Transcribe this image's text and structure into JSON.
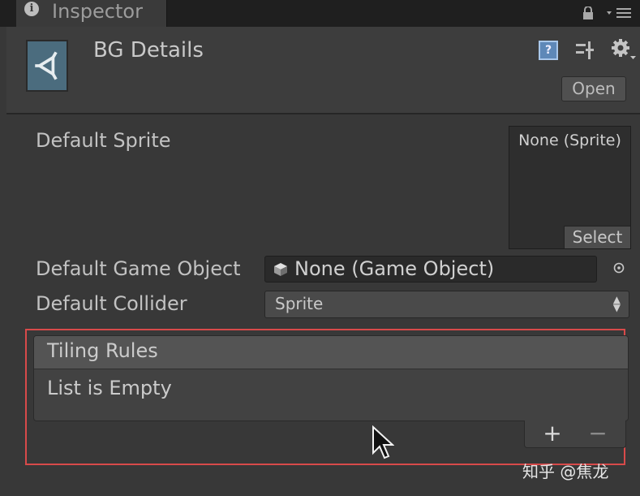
{
  "tab": {
    "title": "Inspector",
    "info_glyph": "i",
    "lock_icon": "lock-icon",
    "menu_icon": "menu-icon"
  },
  "header": {
    "asset_title": "BG Details",
    "help_glyph": "?",
    "open_label": "Open",
    "icons": [
      "unity-logo-icon",
      "help-icon",
      "preset-icon",
      "gear-icon"
    ]
  },
  "fields": {
    "default_sprite": {
      "label": "Default Sprite",
      "value": "None (Sprite)",
      "select_label": "Select"
    },
    "default_game_object": {
      "label": "Default Game Object",
      "value": "None (Game Object)"
    },
    "default_collider": {
      "label": "Default Collider",
      "value": "Sprite"
    }
  },
  "tiling_rules": {
    "header": "Tiling Rules",
    "empty_text": "List is Empty",
    "add_label": "+",
    "remove_label": "−"
  },
  "watermark": "知乎 @焦龙",
  "colors": {
    "background": "#383838",
    "highlight_box": "#d84a4a",
    "help_icon": "#5e88b8"
  }
}
